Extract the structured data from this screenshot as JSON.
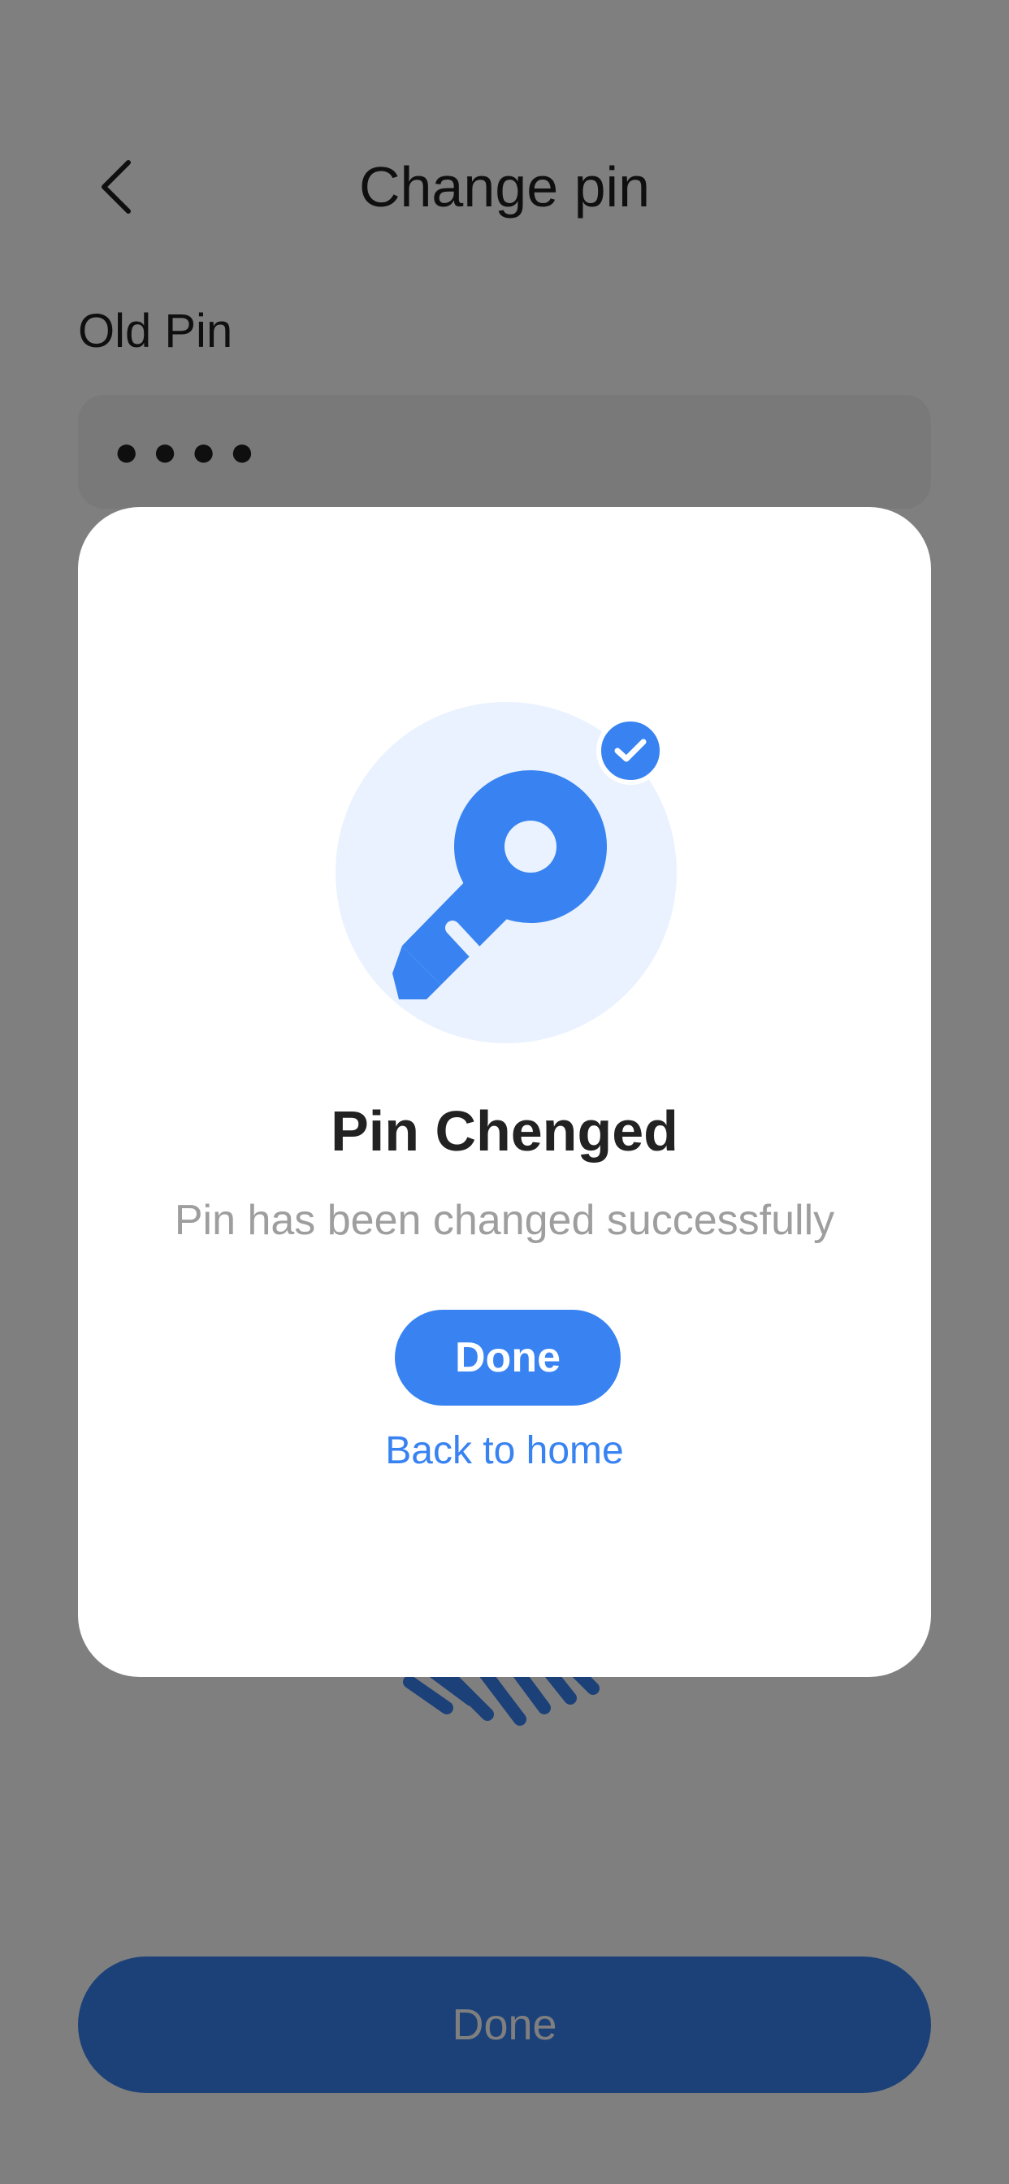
{
  "header": {
    "title": "Change pin",
    "back_icon": "chevron-left-icon"
  },
  "old_pin": {
    "label": "Old Pin",
    "masked_value": "●●●●"
  },
  "fingerprint": {
    "icon": "fingerprint-icon",
    "color": "#3883f1"
  },
  "footer": {
    "done_label": "Done"
  },
  "modal": {
    "icon": "key-icon",
    "badge_icon": "check-badge-icon",
    "title": "Pin Chenged",
    "subtitle": "Pin has been changed successfully",
    "done_label": "Done",
    "back_home_label": "Back to home"
  },
  "colors": {
    "accent": "#3883f1",
    "icon_bg": "#e9f2fe",
    "overlay": "rgba(0,0,0,0.5)",
    "text_dark": "#1f1f1f",
    "text_muted": "#9e9e9e"
  }
}
